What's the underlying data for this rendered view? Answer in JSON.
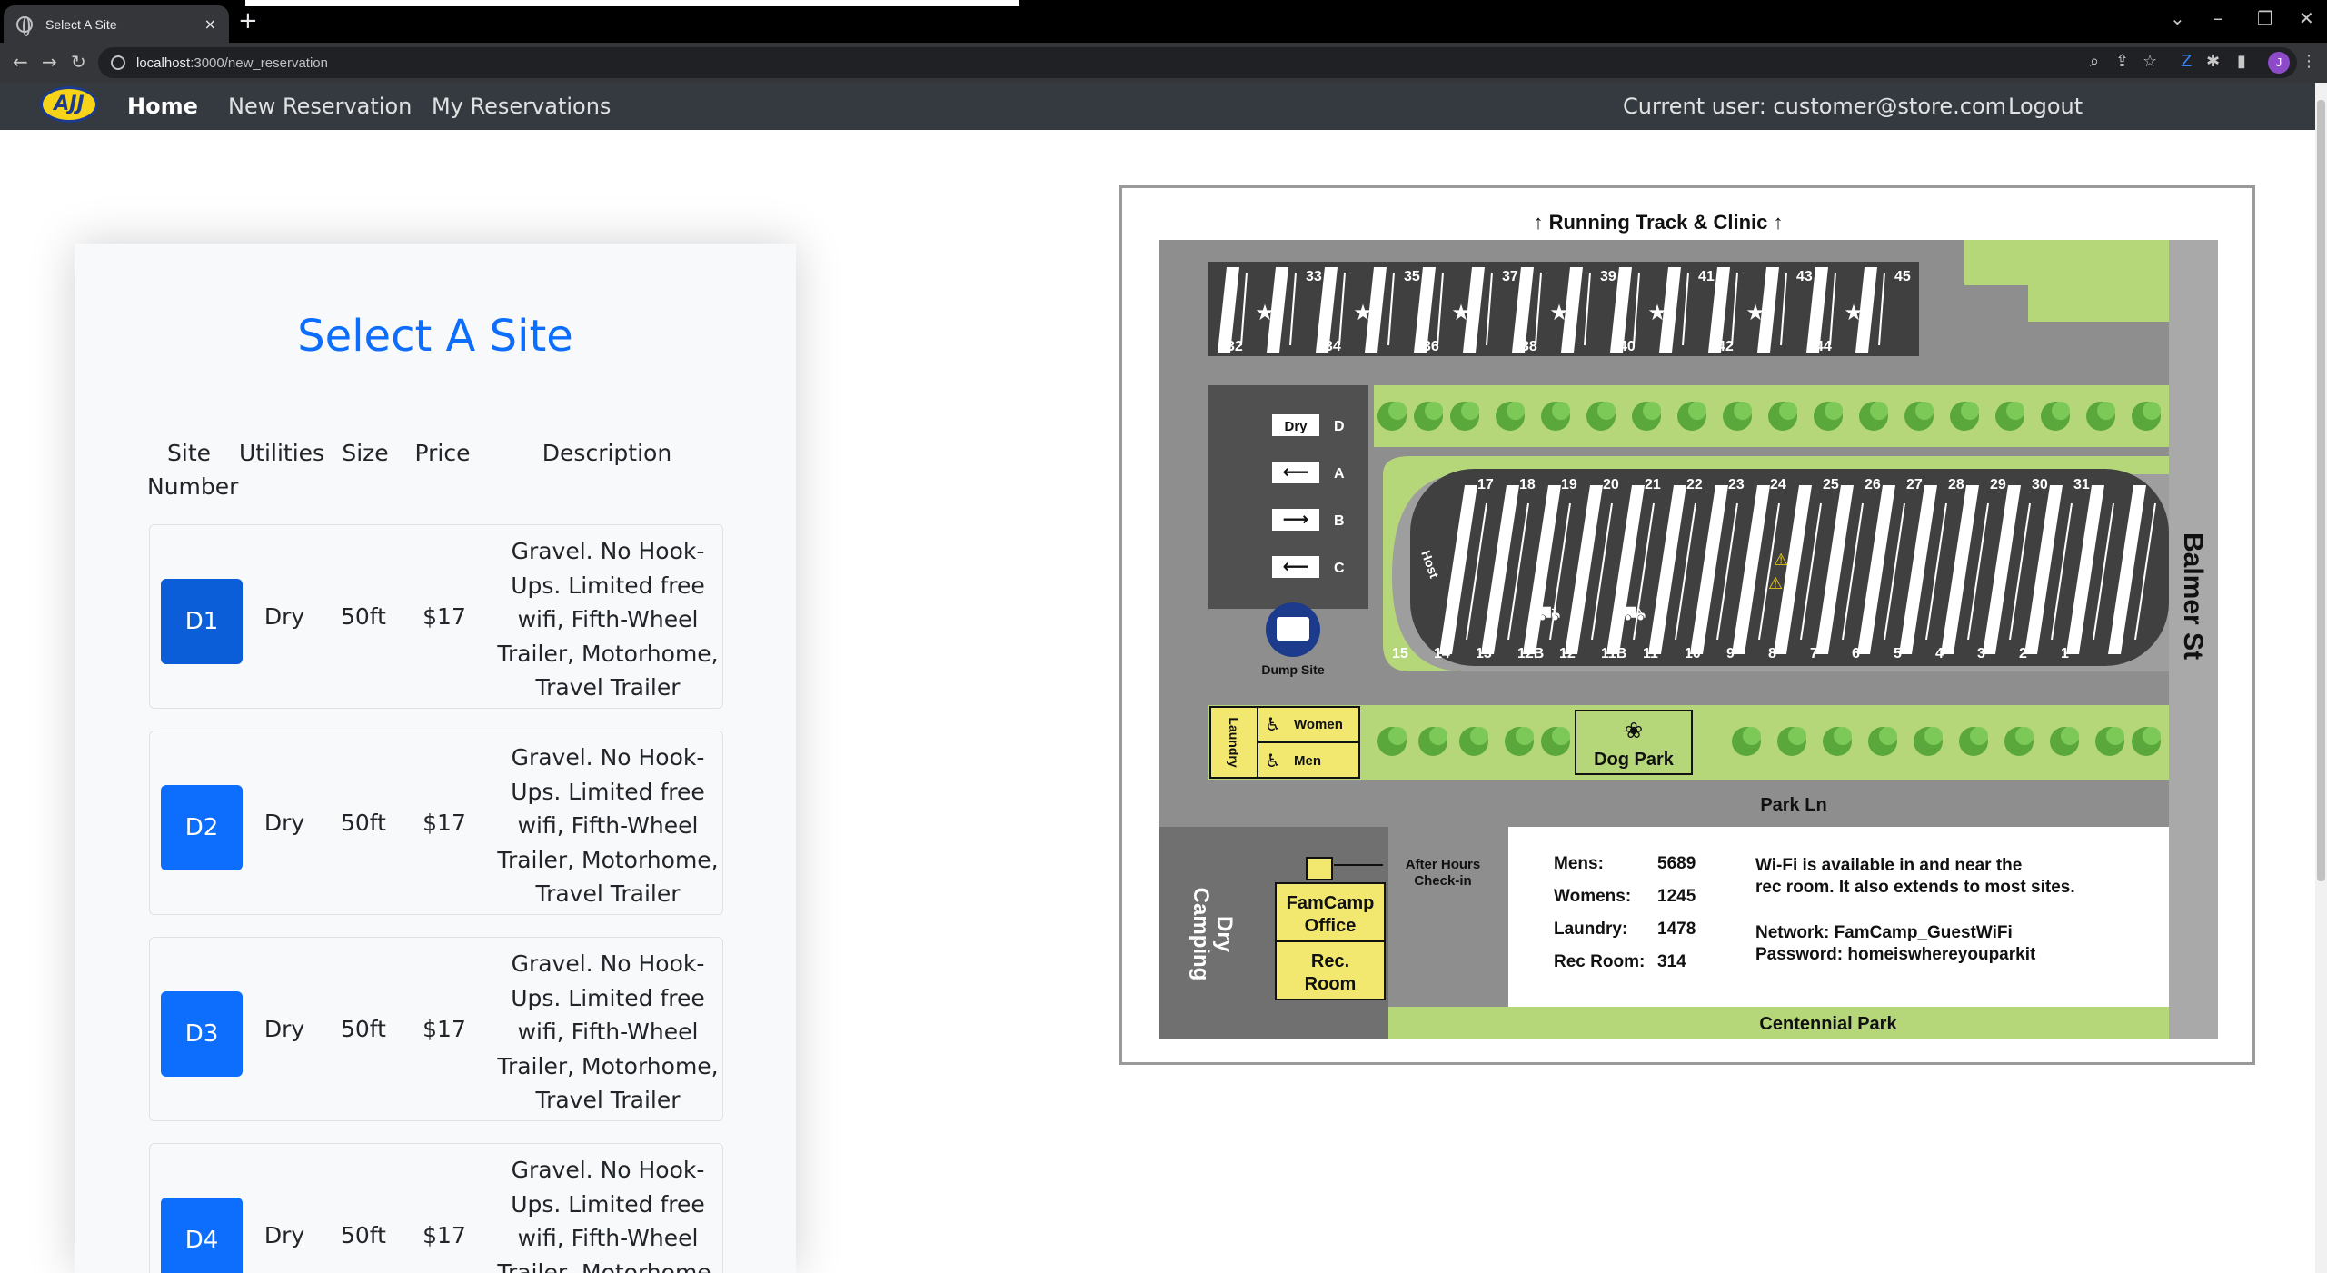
{
  "browser": {
    "tab_title": "Select A Site",
    "tab_close": "×",
    "new_tab": "+",
    "url_host": "localhost",
    "url_rest": ":3000/new_reservation",
    "profile_initial": "J"
  },
  "navbar": {
    "logo_text": "AJJ",
    "home": "Home",
    "new_reservation": "New Reservation",
    "my_reservations": "My Reservations",
    "current_user": "Current user: customer@store.com",
    "logout": "Logout"
  },
  "card": {
    "title": "Select A Site",
    "headers": {
      "site_number": "Site Number",
      "utilities": "Utilities",
      "size": "Size",
      "price": "Price",
      "description": "Description"
    },
    "rows": [
      {
        "site": "D1",
        "utilities": "Dry",
        "size": "50ft",
        "price": "$17",
        "description": "Gravel. No Hook-Ups. Limited free wifi, Fifth-Wheel Trailer, Motorhome, Travel Trailer"
      },
      {
        "site": "D2",
        "utilities": "Dry",
        "size": "50ft",
        "price": "$17",
        "description": "Gravel. No Hook-Ups. Limited free wifi, Fifth-Wheel Trailer, Motorhome, Travel Trailer"
      },
      {
        "site": "D3",
        "utilities": "Dry",
        "size": "50ft",
        "price": "$17",
        "description": "Gravel. No Hook-Ups. Limited free wifi, Fifth-Wheel Trailer, Motorhome, Travel Trailer"
      },
      {
        "site": "D4",
        "utilities": "Dry",
        "size": "50ft",
        "price": "$17",
        "description": "Gravel. No Hook-Ups. Limited free wifi, Fifth-Wheel Trailer, Motorhome, Travel Trailer"
      }
    ]
  },
  "map": {
    "top_label": "↑ Running Track & Clinic ↑",
    "top_sites_odd": [
      "33",
      "35",
      "37",
      "39",
      "41",
      "43",
      "45"
    ],
    "top_sites_even": [
      "32",
      "34",
      "36",
      "38",
      "40",
      "42",
      "44"
    ],
    "mid_sites_top": [
      "17",
      "18",
      "19",
      "20",
      "21",
      "22",
      "23",
      "24",
      "25",
      "26",
      "27",
      "28",
      "29",
      "30",
      "31"
    ],
    "mid_sites_bottom": [
      "15",
      "14",
      "13",
      "12B",
      "12",
      "11B",
      "11",
      "10",
      "9",
      "8",
      "7",
      "6",
      "5",
      "4",
      "3",
      "2",
      "1"
    ],
    "host": "Host",
    "dry": "Dry",
    "lane_d": "D",
    "lane_a": "A",
    "lane_b": "B",
    "lane_c": "C",
    "dump_site": "Dump Site",
    "laundry": "Laundry",
    "women": "Women",
    "men": "Men",
    "dog_park": "Dog Park",
    "park_ln": "Park Ln",
    "balmer_st": "Balmer St",
    "after_hours": "After Hours",
    "check_in": "Check-in",
    "office_line1": "FamCamp",
    "office_line2": "Office",
    "rec_line1": "Rec.",
    "rec_line2": "Room",
    "dry_camping_1": "Dry",
    "dry_camping_2": "Camping",
    "centennial": "Centennial Park",
    "codes": [
      {
        "label": "Mens:",
        "value": "5689"
      },
      {
        "label": "Womens:",
        "value": "1245"
      },
      {
        "label": "Laundry:",
        "value": "1478"
      },
      {
        "label": "Rec Room:",
        "value": "314"
      }
    ],
    "wifi_line1": "Wi-Fi is available in and near the",
    "wifi_line2": "rec room. It also extends to most sites.",
    "network": "Network: FamCamp_GuestWiFi",
    "password": "Password: homeiswhereyouparkit"
  }
}
